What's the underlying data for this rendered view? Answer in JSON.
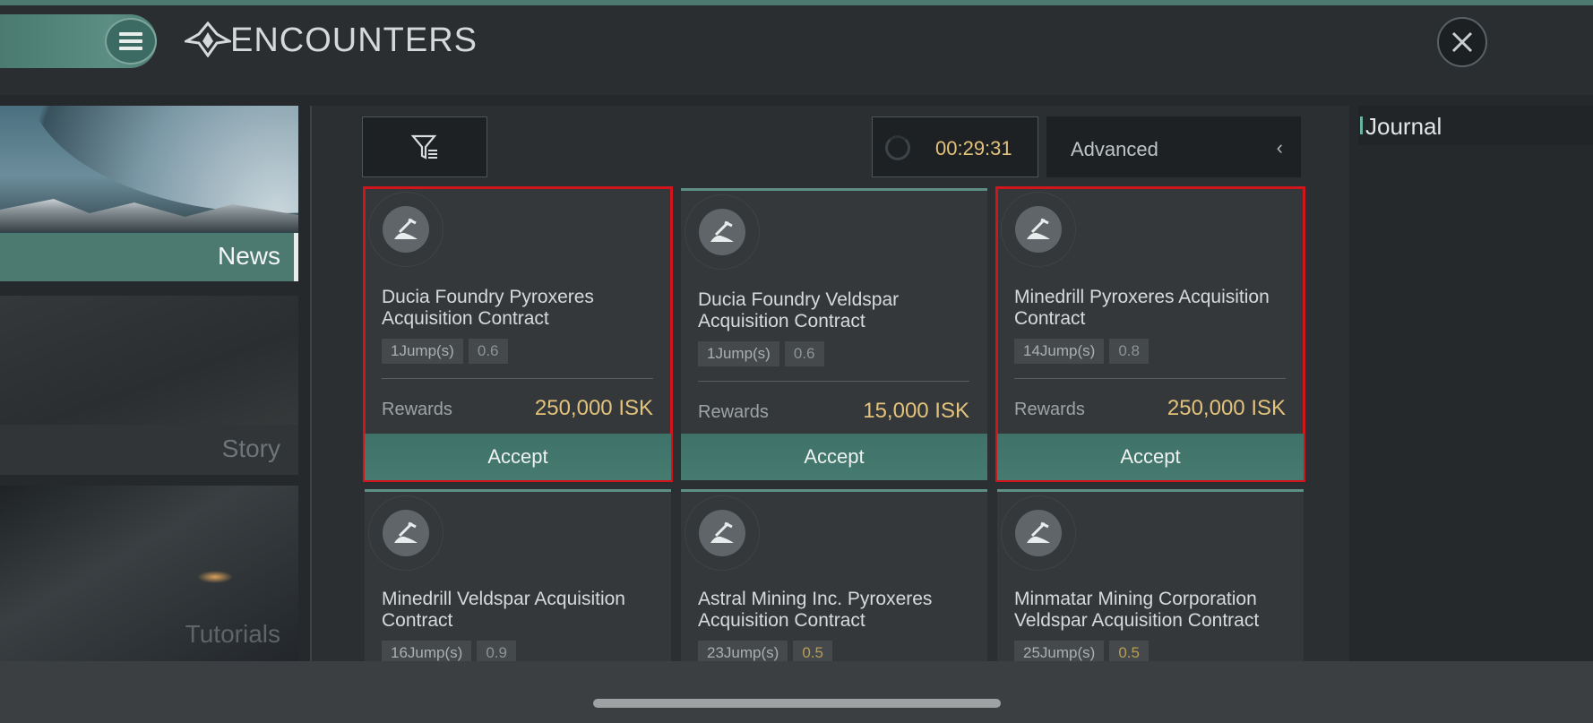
{
  "header": {
    "title": "ENCOUNTERS",
    "menu_icon": "hamburger-menu-icon",
    "logo_icon": "encounters-emblem-icon",
    "close_icon": "close-icon"
  },
  "sidebar": {
    "items": [
      {
        "label": "News",
        "active": true
      },
      {
        "label": "Story",
        "active": false
      },
      {
        "label": "Tutorials",
        "active": false
      }
    ]
  },
  "toolbar": {
    "filter_icon": "filter-icon",
    "timer": "00:29:31",
    "mode_label": "Advanced",
    "mode_icon": "chevron-left-icon"
  },
  "cards": [
    {
      "name": "Ducia Foundry Pyroxeres Acquisition Contract",
      "jumps": "1Jump(s)",
      "security": "0.6",
      "rewards_label": "Rewards",
      "reward": "250,000 ISK",
      "accept_label": "Accept",
      "selected": true
    },
    {
      "name": "Ducia Foundry Veldspar Acquisition Contract",
      "jumps": "1Jump(s)",
      "security": "0.6",
      "rewards_label": "Rewards",
      "reward": "15,000 ISK",
      "accept_label": "Accept",
      "selected": false
    },
    {
      "name": "Minedrill Pyroxeres Acquisition Contract",
      "jumps": "14Jump(s)",
      "security": "0.8",
      "rewards_label": "Rewards",
      "reward": "250,000 ISK",
      "accept_label": "Accept",
      "selected": true
    },
    {
      "name": "Minedrill Veldspar Acquisition Contract",
      "jumps": "16Jump(s)",
      "security": "0.9"
    },
    {
      "name": "Astral Mining Inc. Pyroxeres Acquisition Contract",
      "jumps": "23Jump(s)",
      "security": "0.5"
    },
    {
      "name": "Minmatar Mining Corporation Veldspar Acquisition Contract",
      "jumps": "25Jump(s)",
      "security": "0.5"
    }
  ],
  "card_icon": "mining-icon",
  "journal": {
    "title": "Journal"
  },
  "colors": {
    "accent": "#4c7a71",
    "reward": "#e3c27b",
    "selection": "#d2141c"
  }
}
